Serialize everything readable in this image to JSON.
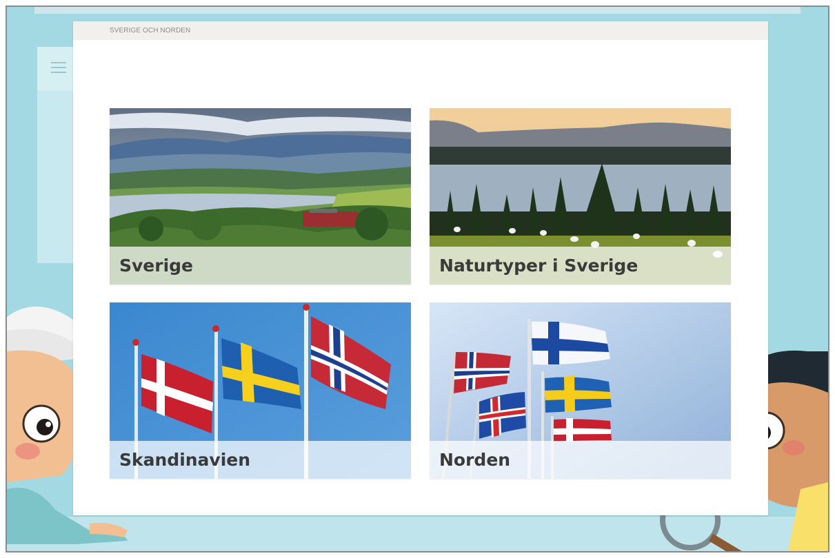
{
  "breadcrumb": "SVERIGE OCH NORDEN",
  "sidebar": {
    "menu_icon": "hamburger-menu-icon"
  },
  "tiles": [
    {
      "label": "Sverige"
    },
    {
      "label": "Naturtyper i Sverige"
    },
    {
      "label": "Skandinavien"
    },
    {
      "label": "Norden"
    }
  ],
  "colors": {
    "background": "#a3d9e2",
    "card": "#ffffff",
    "card_header": "#f2f0ec",
    "label_text": "#3a3a3a"
  }
}
